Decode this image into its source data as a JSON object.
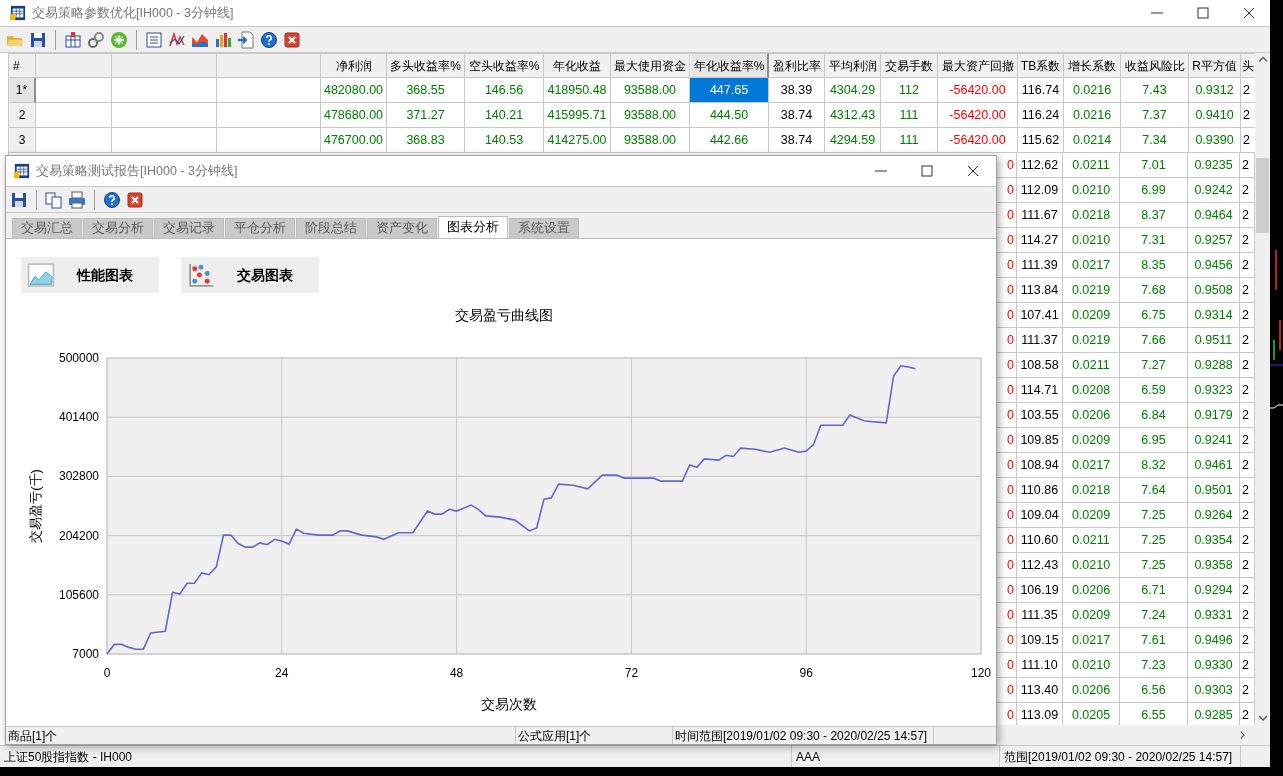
{
  "main_window": {
    "title": "交易策略参数优化[IH000 - 3分钟线]",
    "table": {
      "corner": "#",
      "columns": [
        {
          "label": "净利润",
          "color": "#008000",
          "selected": false
        },
        {
          "label": "多头收益率%",
          "color": "#008000",
          "selected": false
        },
        {
          "label": "空头收益率%",
          "color": "#008000",
          "selected": false
        },
        {
          "label": "年化收益",
          "color": "#008000",
          "selected": false
        },
        {
          "label": "最大使用资金",
          "color": "#008000",
          "selected": false
        },
        {
          "label": "年化收益率%",
          "color": "#008000",
          "selected": true
        },
        {
          "label": "盈利比率",
          "color": "#000000",
          "selected": false
        },
        {
          "label": "平均利润",
          "color": "#008000",
          "selected": false
        },
        {
          "label": "交易手数",
          "color": "#008000",
          "selected": false
        },
        {
          "label": "最大资产回撤",
          "color": "#ff0000",
          "selected": false
        },
        {
          "label": "TB系数",
          "color": "#000000",
          "selected": false
        },
        {
          "label": "增长系数",
          "color": "#008000",
          "selected": false
        },
        {
          "label": "收益风险比",
          "color": "#008000",
          "selected": false
        },
        {
          "label": "R平方值",
          "color": "#008000",
          "selected": false
        },
        {
          "label": "头",
          "color": "#000000",
          "selected": false
        }
      ],
      "rows": [
        {
          "header": "1*",
          "selected": true,
          "cells": [
            "482080.00",
            "368.55",
            "146.56",
            "418950.48",
            "93588.00",
            "447.65",
            "38.39",
            "4304.29",
            "112",
            "-56420.00",
            "116.74",
            "0.0216",
            "7.43",
            "0.9312",
            "2"
          ]
        },
        {
          "header": "2",
          "selected": false,
          "cells": [
            "478680.00",
            "371.27",
            "140.21",
            "415995.71",
            "93588.00",
            "444.50",
            "38.74",
            "4312.43",
            "111",
            "-56420.00",
            "116.24",
            "0.0216",
            "7.37",
            "0.9410",
            "2"
          ]
        },
        {
          "header": "3",
          "selected": false,
          "cells": [
            "476700.00",
            "368.83",
            "140.53",
            "414275.00",
            "93588.00",
            "442.66",
            "38.74",
            "4294.59",
            "111",
            "-56420.00",
            "115.62",
            "0.0214",
            "7.34",
            "0.9390",
            "2"
          ]
        },
        {
          "selected": false,
          "cells": [
            "0",
            "112.62",
            "0.0211",
            "7.01",
            "0.9235",
            "2"
          ]
        },
        {
          "selected": false,
          "cells": [
            "0",
            "112.09",
            "0.0210",
            "6.99",
            "0.9242",
            "2"
          ]
        },
        {
          "selected": false,
          "cells": [
            "0",
            "111.67",
            "0.0218",
            "8.37",
            "0.9464",
            "2"
          ]
        },
        {
          "selected": false,
          "cells": [
            "0",
            "114.27",
            "0.0210",
            "7.31",
            "0.9257",
            "2"
          ]
        },
        {
          "selected": false,
          "cells": [
            "0",
            "111.39",
            "0.0217",
            "8.35",
            "0.9456",
            "2"
          ]
        },
        {
          "selected": false,
          "cells": [
            "0",
            "113.84",
            "0.0219",
            "7.68",
            "0.9508",
            "2"
          ]
        },
        {
          "selected": false,
          "cells": [
            "0",
            "107.41",
            "0.0209",
            "6.75",
            "0.9314",
            "2"
          ]
        },
        {
          "selected": false,
          "cells": [
            "0",
            "111.37",
            "0.0219",
            "7.66",
            "0.9511",
            "2"
          ]
        },
        {
          "selected": false,
          "cells": [
            "0",
            "108.58",
            "0.0211",
            "7.27",
            "0.9288",
            "2"
          ]
        },
        {
          "selected": false,
          "cells": [
            "0",
            "114.71",
            "0.0208",
            "6.59",
            "0.9323",
            "2"
          ]
        },
        {
          "selected": false,
          "cells": [
            "0",
            "103.55",
            "0.0206",
            "6.84",
            "0.9179",
            "2"
          ]
        },
        {
          "selected": false,
          "cells": [
            "0",
            "109.85",
            "0.0209",
            "6.95",
            "0.9241",
            "2"
          ]
        },
        {
          "selected": false,
          "cells": [
            "0",
            "108.94",
            "0.0217",
            "8.32",
            "0.9461",
            "2"
          ]
        },
        {
          "selected": false,
          "cells": [
            "0",
            "110.86",
            "0.0218",
            "7.64",
            "0.9501",
            "2"
          ]
        },
        {
          "selected": false,
          "cells": [
            "0",
            "109.04",
            "0.0209",
            "7.25",
            "0.9264",
            "2"
          ]
        },
        {
          "selected": false,
          "cells": [
            "0",
            "110.60",
            "0.0211",
            "7.25",
            "0.9354",
            "2"
          ]
        },
        {
          "selected": false,
          "cells": [
            "0",
            "112.43",
            "0.0210",
            "7.25",
            "0.9358",
            "2"
          ]
        },
        {
          "selected": false,
          "cells": [
            "0",
            "106.19",
            "0.0206",
            "6.71",
            "0.9294",
            "2"
          ]
        },
        {
          "selected": false,
          "cells": [
            "0",
            "111.35",
            "0.0209",
            "7.24",
            "0.9331",
            "2"
          ]
        },
        {
          "selected": false,
          "cells": [
            "0",
            "109.15",
            "0.0217",
            "7.61",
            "0.9496",
            "2"
          ]
        },
        {
          "selected": false,
          "cells": [
            "0",
            "111.10",
            "0.0210",
            "7.23",
            "0.9330",
            "2"
          ]
        },
        {
          "selected": false,
          "cells": [
            "0",
            "113.40",
            "0.0206",
            "6.56",
            "0.9303",
            "2"
          ]
        },
        {
          "selected": false,
          "cells": [
            "0",
            "113.09",
            "0.0205",
            "6.55",
            "0.9285",
            "2"
          ]
        }
      ]
    },
    "status_bar": [
      "上证50股指指数 - IH000",
      "AAA",
      "范围[2019/01/02 09:30 - 2020/02/25 14:57]"
    ]
  },
  "report_window": {
    "title": "交易策略测试报告[IH000 - 3分钟线]",
    "tabs": [
      {
        "label": "交易汇总",
        "selected": false
      },
      {
        "label": "交易分析",
        "selected": false
      },
      {
        "label": "交易记录",
        "selected": false
      },
      {
        "label": "平仓分析",
        "selected": false
      },
      {
        "label": "阶段总结",
        "selected": false
      },
      {
        "label": "资产变化",
        "selected": false
      },
      {
        "label": "图表分析",
        "selected": true
      },
      {
        "label": "系统设置",
        "selected": false
      }
    ],
    "chart_buttons": [
      "性能图表",
      "交易图表"
    ],
    "chart_data": {
      "type": "line",
      "grid": true,
      "title": "交易盈亏曲线图",
      "xlabel": "交易次数",
      "ylabel": "交易盈亏(千)",
      "xlim": [
        0,
        120
      ],
      "ylim": [
        7000,
        500000
      ],
      "xticks": [
        0,
        24,
        48,
        72,
        96,
        120
      ],
      "yticks": [
        7000,
        105600,
        204200,
        302800,
        401400,
        500000
      ],
      "x": [
        0,
        1,
        2,
        3,
        4,
        5,
        6,
        8,
        9,
        10,
        11,
        12,
        13,
        14,
        15,
        16,
        17,
        18,
        19,
        20,
        21,
        22,
        23,
        24,
        25,
        26,
        27,
        29,
        31,
        32,
        33,
        35,
        37,
        38,
        40,
        42,
        44,
        45,
        46,
        47,
        48,
        50,
        51,
        52,
        54,
        56,
        58,
        59,
        60,
        61,
        62,
        64,
        66,
        68,
        70,
        71,
        75,
        76,
        79,
        80,
        81,
        82,
        84,
        85,
        86,
        87,
        89,
        91,
        93,
        95,
        96,
        97,
        98,
        101,
        102,
        104,
        107,
        108,
        109,
        110,
        111
      ],
      "values": [
        7000,
        23000,
        23000,
        18000,
        15000,
        15000,
        42000,
        45000,
        110000,
        107000,
        125000,
        125000,
        142000,
        139000,
        152000,
        205000,
        205000,
        191000,
        185000,
        185000,
        192000,
        189000,
        198000,
        195000,
        190000,
        215000,
        208000,
        205000,
        205000,
        212000,
        212000,
        205000,
        202000,
        198000,
        209000,
        209000,
        245000,
        240000,
        240000,
        248000,
        245000,
        255000,
        248000,
        237000,
        235000,
        230000,
        212000,
        217000,
        265000,
        267000,
        290000,
        288000,
        282000,
        305000,
        305000,
        300000,
        300000,
        295000,
        295000,
        322000,
        318000,
        332000,
        330000,
        338000,
        336000,
        350000,
        348000,
        343000,
        350000,
        343000,
        345000,
        356000,
        388000,
        388000,
        405000,
        395000,
        392000,
        470000,
        487000,
        485000,
        482000
      ]
    },
    "status_bar": [
      "商品[1]个",
      "公式应用[1]个",
      "时间范围[2019/01/02 09:30 - 2020/02/25 14:57]"
    ]
  }
}
